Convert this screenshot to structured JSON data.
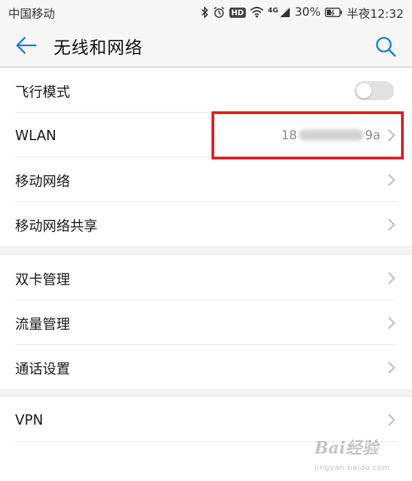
{
  "status_bar": {
    "carrier": "中国移动",
    "network_type": "4G",
    "battery": "30%",
    "time": "半夜12:32",
    "hd_label": "HD",
    "icons": [
      "bluetooth-icon",
      "alarm-icon",
      "hd-icon",
      "wifi-icon",
      "signal-icon",
      "battery-icon"
    ]
  },
  "header": {
    "title": "无线和网络",
    "back_icon": "back-arrow-icon",
    "search_icon": "search-icon",
    "accent_color": "#1a7fd0"
  },
  "sections": [
    {
      "items": [
        {
          "label": "飞行模式",
          "control": "toggle",
          "toggle_on": false
        },
        {
          "label": "WLAN",
          "value_prefix": "18",
          "value_suffix": "9a",
          "value_masked": true,
          "control": "chevron"
        },
        {
          "label": "移动网络",
          "control": "chevron"
        },
        {
          "label": "移动网络共享",
          "control": "chevron"
        }
      ]
    },
    {
      "items": [
        {
          "label": "双卡管理",
          "control": "chevron"
        },
        {
          "label": "流量管理",
          "control": "chevron"
        },
        {
          "label": "通话设置",
          "control": "chevron"
        }
      ]
    },
    {
      "items": [
        {
          "label": "VPN",
          "control": "chevron"
        }
      ]
    }
  ],
  "annotation": {
    "highlight_color": "#e31b23"
  },
  "watermark": {
    "text": "Bai经验",
    "subtext": "jingyan.baidu.com"
  }
}
